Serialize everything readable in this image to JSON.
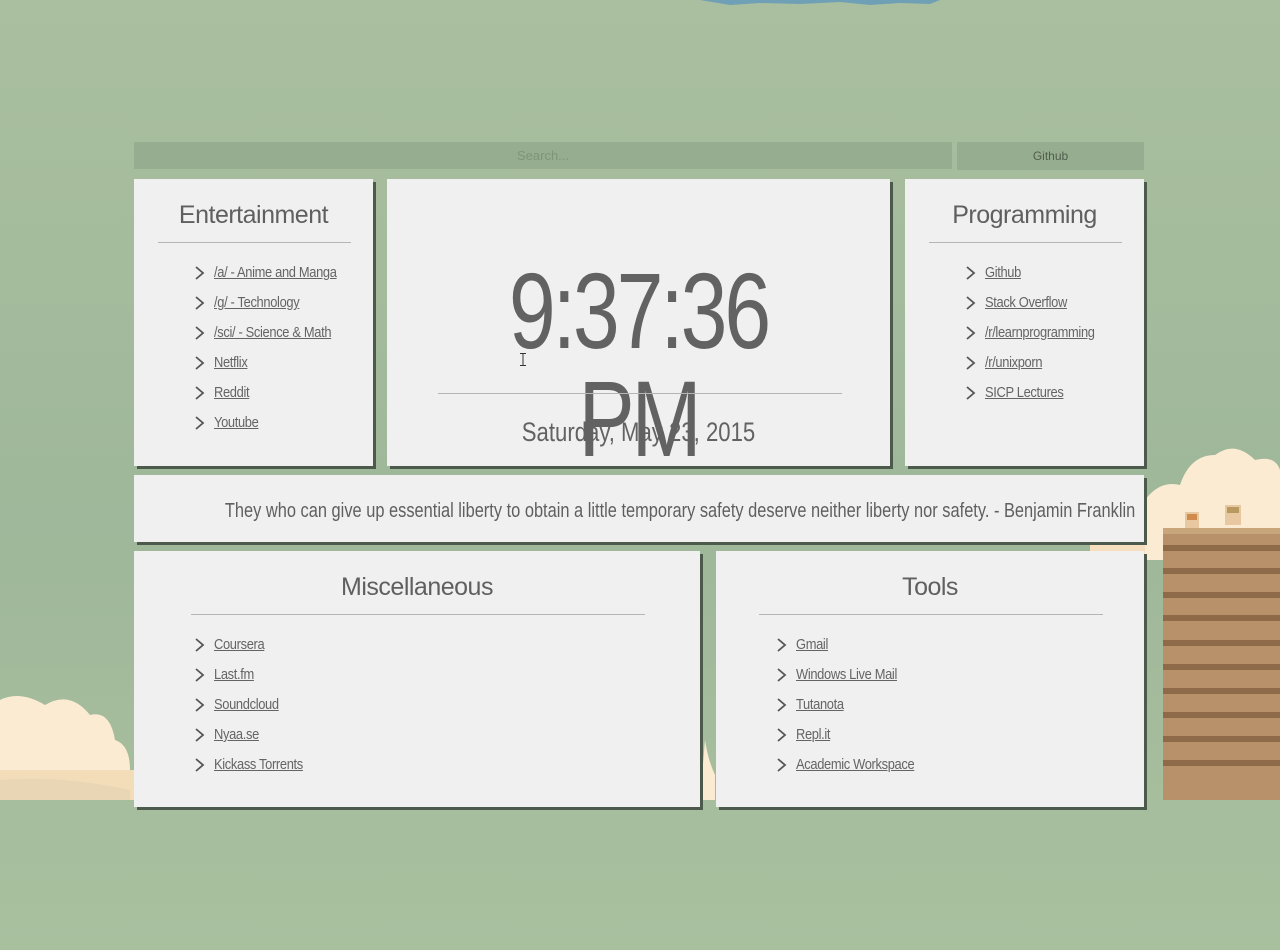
{
  "search": {
    "placeholder": "Search..."
  },
  "github_button": {
    "label": "Github"
  },
  "clock": {
    "time": "9:37:36 PM",
    "date": "Saturday, May 23, 2015"
  },
  "quote": {
    "text": "They who can give up essential liberty to obtain a little temporary safety deserve neither liberty nor safety. - Benjamin Franklin"
  },
  "entertainment": {
    "title": "Entertainment",
    "links": [
      {
        "label": "/a/ - Anime and Manga"
      },
      {
        "label": "/g/ - Technology"
      },
      {
        "label": "/sci/ - Science & Math"
      },
      {
        "label": "Netflix"
      },
      {
        "label": "Reddit"
      },
      {
        "label": "Youtube"
      }
    ]
  },
  "programming": {
    "title": "Programming",
    "links": [
      {
        "label": "Github"
      },
      {
        "label": "Stack Overflow"
      },
      {
        "label": "/r/learnprogramming"
      },
      {
        "label": "/r/unixporn"
      },
      {
        "label": "SICP Lectures"
      }
    ]
  },
  "miscellaneous": {
    "title": "Miscellaneous",
    "links": [
      {
        "label": "Coursera"
      },
      {
        "label": "Last.fm"
      },
      {
        "label": "Soundcloud"
      },
      {
        "label": "Nyaa.se"
      },
      {
        "label": "Kickass Torrents"
      }
    ]
  },
  "tools": {
    "title": "Tools",
    "links": [
      {
        "label": "Gmail"
      },
      {
        "label": "Windows Live Mail"
      },
      {
        "label": "Tutanota"
      },
      {
        "label": "Repl.it"
      },
      {
        "label": "Academic Workspace"
      }
    ]
  },
  "colors": {
    "background": "#a9bf9f",
    "panel": "#f0f0f0",
    "panel_shadow": "#4b5a4a",
    "text": "#646464",
    "searchbar": "#97ad90"
  },
  "icons": {
    "link_bullet": "chevron-right-icon"
  }
}
